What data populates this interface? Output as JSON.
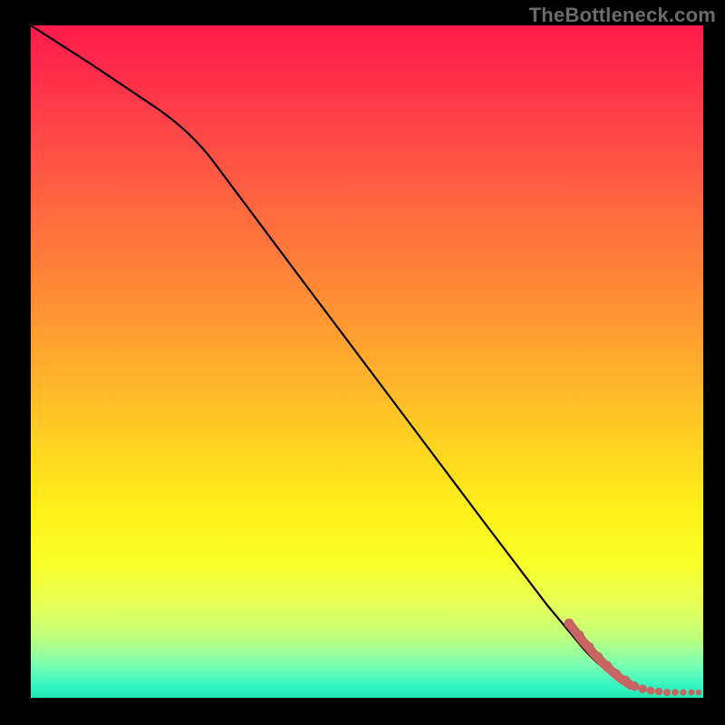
{
  "watermark": "TheBottleneck.com",
  "colors": {
    "background": "#000000",
    "curve": "#000000",
    "marker": "#c86563"
  },
  "chart_data": {
    "type": "line",
    "title": "",
    "xlabel": "",
    "ylabel": "",
    "xlim": [
      0,
      100
    ],
    "ylim": [
      0,
      100
    ],
    "grid": false,
    "legend": false,
    "note": "No axis ticks or numeric labels are visible; values below are estimated from pixel positions on a 0–100 normalized scale (x rightward, y upward).",
    "series": [
      {
        "name": "black-curve",
        "style": "line",
        "color": "#000000",
        "x": [
          0,
          7,
          14,
          21,
          28,
          35,
          42,
          49,
          56,
          63,
          70,
          77,
          82,
          86,
          89
        ],
        "y": [
          100,
          94,
          88,
          82,
          74,
          65,
          56,
          47,
          38,
          29,
          20,
          12,
          7,
          4,
          2
        ]
      },
      {
        "name": "tail-markers",
        "style": "scatter",
        "color": "#c86563",
        "x": [
          80,
          81.5,
          83,
          84,
          85,
          86,
          87,
          88,
          89,
          90,
          91.5,
          93,
          94.5,
          96,
          97.5,
          99
        ],
        "y": [
          11,
          9.5,
          8,
          6.8,
          5.6,
          4.6,
          3.8,
          3.0,
          2.4,
          1.8,
          1.4,
          1.1,
          0.9,
          0.8,
          0.7,
          0.6
        ]
      }
    ]
  }
}
